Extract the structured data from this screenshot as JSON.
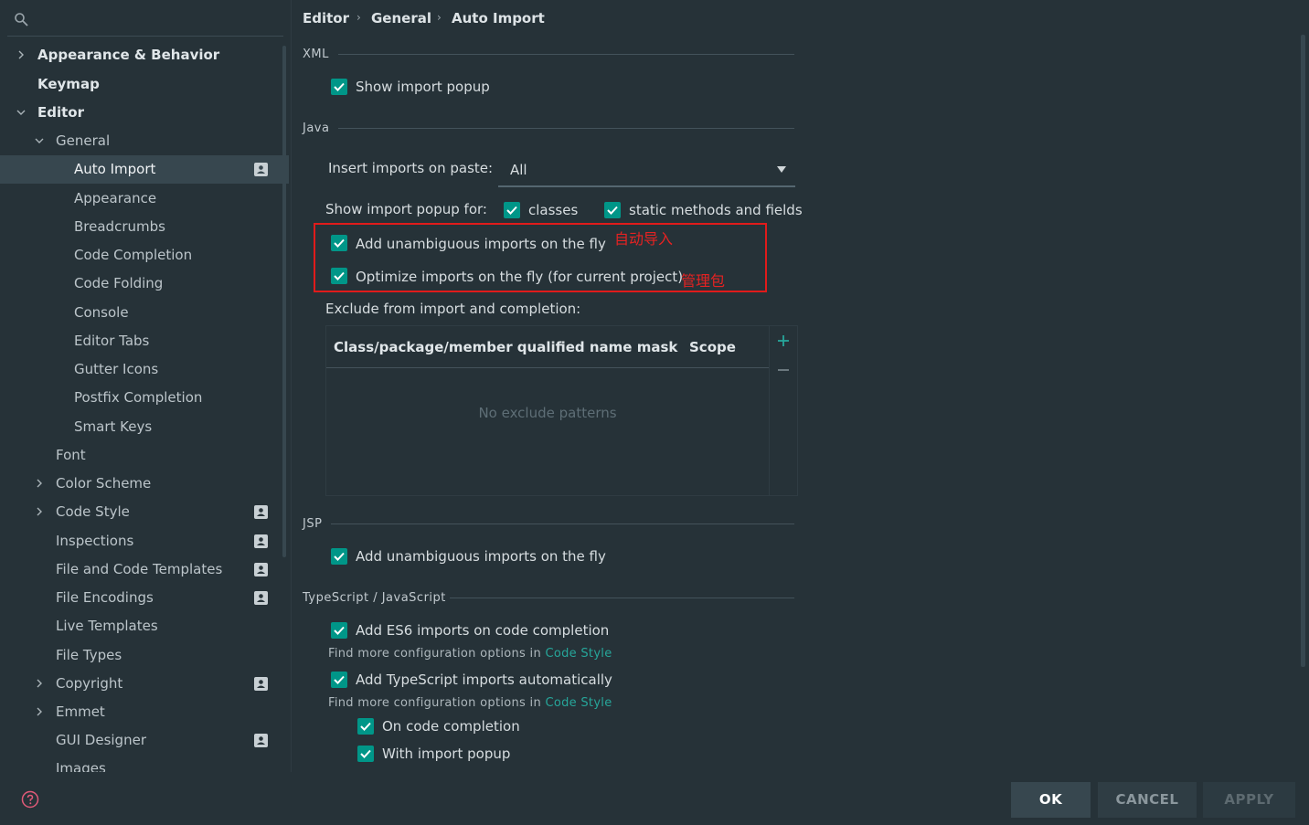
{
  "search": {
    "placeholder": "",
    "icon": "search-icon"
  },
  "sidebar": {
    "items": [
      {
        "label": "Appearance & Behavior"
      },
      {
        "label": "Keymap"
      },
      {
        "label": "Editor"
      },
      {
        "label": "General"
      },
      {
        "label": "Auto Import"
      },
      {
        "label": "Appearance"
      },
      {
        "label": "Breadcrumbs"
      },
      {
        "label": "Code Completion"
      },
      {
        "label": "Code Folding"
      },
      {
        "label": "Console"
      },
      {
        "label": "Editor Tabs"
      },
      {
        "label": "Gutter Icons"
      },
      {
        "label": "Postfix Completion"
      },
      {
        "label": "Smart Keys"
      },
      {
        "label": "Font"
      },
      {
        "label": "Color Scheme"
      },
      {
        "label": "Code Style"
      },
      {
        "label": "Inspections"
      },
      {
        "label": "File and Code Templates"
      },
      {
        "label": "File Encodings"
      },
      {
        "label": "Live Templates"
      },
      {
        "label": "File Types"
      },
      {
        "label": "Copyright"
      },
      {
        "label": "Emmet"
      },
      {
        "label": "GUI Designer"
      },
      {
        "label": "Images"
      }
    ]
  },
  "breadcrumb": [
    "Editor",
    "General",
    "Auto Import"
  ],
  "xml": {
    "title": "XML",
    "show_import_popup": "Show import popup"
  },
  "java": {
    "title": "Java",
    "insert_label": "Insert imports on paste:",
    "insert_value": "All",
    "popup_for_label": "Show import popup for:",
    "classes": "classes",
    "static_methods": "static methods and fields",
    "add_unambiguous": "Add unambiguous imports on the fly",
    "optimize": "Optimize imports on the fly (for current project)",
    "exclude_label": "Exclude from import and completion:",
    "table_col_mask": "Class/package/member qualified name mask",
    "table_col_scope": "Scope",
    "table_empty": "No exclude patterns"
  },
  "annotations": {
    "auto_import": "自动导入",
    "manage_packages": "管理包"
  },
  "jsp": {
    "title": "JSP",
    "add_unambiguous": "Add unambiguous imports on the fly"
  },
  "ts": {
    "title": "TypeScript / JavaScript",
    "es6": "Add ES6 imports on code completion",
    "hint_prefix": "Find more configuration options in",
    "hint_link": "Code Style",
    "ts_auto": "Add TypeScript imports automatically",
    "hint2_prefix": "Find more configuration options in",
    "hint2_link": "Code Style",
    "on_completion": "On code completion",
    "with_popup": "With import popup"
  },
  "footer": {
    "ok": "OK",
    "cancel": "CANCEL",
    "apply": "APPLY"
  },
  "colors": {
    "accent": "#009688",
    "background": "#263238",
    "selected": "#37474f",
    "annotation": "#e01b1b",
    "link": "#26a69a"
  }
}
